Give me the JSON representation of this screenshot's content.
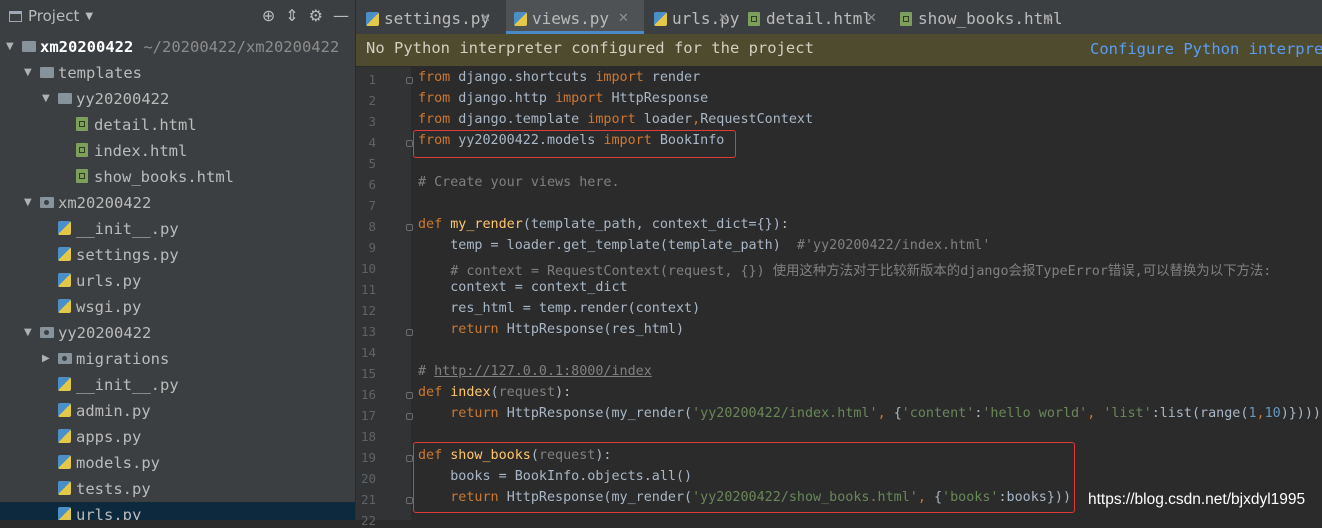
{
  "sidebar": {
    "title": "Project",
    "tools": [
      "target-icon",
      "collapse-icon",
      "gear-icon",
      "hide-icon"
    ],
    "tree": [
      {
        "name": "xm20200422",
        "path": "~/20200422/xm20200422",
        "type": "root",
        "expanded": true
      },
      {
        "name": "templates",
        "type": "folder",
        "expanded": true
      },
      {
        "name": "yy20200422",
        "type": "folder",
        "expanded": true
      },
      {
        "name": "detail.html",
        "type": "html"
      },
      {
        "name": "index.html",
        "type": "html"
      },
      {
        "name": "show_books.html",
        "type": "html"
      },
      {
        "name": "xm20200422",
        "type": "package",
        "expanded": true
      },
      {
        "name": "__init__.py",
        "type": "py"
      },
      {
        "name": "settings.py",
        "type": "py"
      },
      {
        "name": "urls.py",
        "type": "py"
      },
      {
        "name": "wsgi.py",
        "type": "py"
      },
      {
        "name": "yy20200422",
        "type": "package",
        "expanded": true
      },
      {
        "name": "migrations",
        "type": "package",
        "expanded": false
      },
      {
        "name": "__init__.py",
        "type": "py"
      },
      {
        "name": "admin.py",
        "type": "py"
      },
      {
        "name": "apps.py",
        "type": "py"
      },
      {
        "name": "models.py",
        "type": "py"
      },
      {
        "name": "tests.py",
        "type": "py"
      },
      {
        "name": "urls.py",
        "type": "py",
        "selected": true
      }
    ]
  },
  "tabs": [
    {
      "label": "settings.py",
      "type": "py",
      "active": false
    },
    {
      "label": "views.py",
      "type": "py",
      "active": true
    },
    {
      "label": "urls.py",
      "type": "py",
      "active": false
    },
    {
      "label": "detail.html",
      "type": "html",
      "active": false
    },
    {
      "label": "show_books.html",
      "type": "html",
      "active": false
    }
  ],
  "banner": {
    "message": "No Python interpreter configured for the project",
    "link": "Configure Python interpreter"
  },
  "editor": {
    "lines": [
      {
        "n": "1",
        "spans": [
          [
            "kw",
            "from"
          ],
          [
            "t",
            " django.shortcuts "
          ],
          [
            "kw",
            "import"
          ],
          [
            "t",
            " render"
          ]
        ]
      },
      {
        "n": "2",
        "spans": [
          [
            "kw",
            "from"
          ],
          [
            "t",
            " django.http "
          ],
          [
            "kw",
            "import"
          ],
          [
            "t",
            " HttpResponse"
          ]
        ]
      },
      {
        "n": "3",
        "spans": [
          [
            "kw",
            "from"
          ],
          [
            "t",
            " django.template "
          ],
          [
            "kw",
            "import"
          ],
          [
            "t",
            " loader"
          ],
          [
            "kw",
            ","
          ],
          [
            "t",
            "RequestContext"
          ]
        ]
      },
      {
        "n": "4",
        "spans": [
          [
            "kw",
            "from"
          ],
          [
            "t",
            " yy20200422.models "
          ],
          [
            "kw",
            "import"
          ],
          [
            "t",
            " BookInfo"
          ]
        ]
      },
      {
        "n": "5",
        "spans": []
      },
      {
        "n": "6",
        "spans": [
          [
            "cm",
            "# Create your views here."
          ]
        ]
      },
      {
        "n": "7",
        "spans": []
      },
      {
        "n": "8",
        "spans": [
          [
            "kw",
            "def "
          ],
          [
            "fn",
            "my_render"
          ],
          [
            "t",
            "(template_path, context_dict={}):"
          ]
        ]
      },
      {
        "n": "9",
        "spans": [
          [
            "t",
            "    temp = loader.get_template(template_path)  "
          ],
          [
            "cm",
            "#'yy20200422/index.html'"
          ]
        ]
      },
      {
        "n": "10",
        "spans": [
          [
            "cm",
            "    # context = RequestContext(request, {}) 使用这种方法对于比较新版本的django会报TypeError错误,可以替换为以下方法:"
          ]
        ]
      },
      {
        "n": "11",
        "spans": [
          [
            "t",
            "    context = context_dict"
          ]
        ]
      },
      {
        "n": "12",
        "spans": [
          [
            "t",
            "    res_html = temp.render(context)"
          ]
        ]
      },
      {
        "n": "13",
        "spans": [
          [
            "kw",
            "    return "
          ],
          [
            "t",
            "HttpResponse(res_html)"
          ]
        ]
      },
      {
        "n": "14",
        "spans": []
      },
      {
        "n": "15",
        "spans": [
          [
            "cm",
            "# "
          ],
          [
            "url",
            "http://127.0.0.1:8000/index"
          ]
        ]
      },
      {
        "n": "16",
        "spans": [
          [
            "kw",
            "def "
          ],
          [
            "fn",
            "index"
          ],
          [
            "t",
            "("
          ],
          [
            "par",
            "request"
          ],
          [
            "t",
            "):"
          ]
        ]
      },
      {
        "n": "17",
        "spans": [
          [
            "kw",
            "    return "
          ],
          [
            "t",
            "HttpResponse(my_render("
          ],
          [
            "str",
            "'yy20200422/index.html'"
          ],
          [
            "kw",
            ", "
          ],
          [
            "t",
            "{"
          ],
          [
            "str",
            "'content'"
          ],
          [
            "t",
            ":"
          ],
          [
            "str",
            "'hello world'"
          ],
          [
            "kw",
            ", "
          ],
          [
            "str",
            "'list'"
          ],
          [
            "t",
            ":list(range("
          ],
          [
            "num",
            "1"
          ],
          [
            "kw",
            ","
          ],
          [
            "num",
            "10"
          ],
          [
            "t",
            ")})))"
          ]
        ]
      },
      {
        "n": "18",
        "spans": []
      },
      {
        "n": "19",
        "spans": [
          [
            "kw",
            "def "
          ],
          [
            "fn",
            "show_books"
          ],
          [
            "t",
            "("
          ],
          [
            "par",
            "request"
          ],
          [
            "t",
            "):"
          ]
        ]
      },
      {
        "n": "20",
        "spans": [
          [
            "t",
            "    books = BookInfo.objects.all()"
          ]
        ]
      },
      {
        "n": "21",
        "spans": [
          [
            "kw",
            "    return "
          ],
          [
            "t",
            "HttpResponse(my_render("
          ],
          [
            "str",
            "'yy20200422/show_books.html'"
          ],
          [
            "kw",
            ", "
          ],
          [
            "t",
            "{"
          ],
          [
            "str",
            "'books'"
          ],
          [
            "t",
            ":books}))"
          ]
        ]
      },
      {
        "n": "22",
        "spans": []
      }
    ]
  },
  "watermark": "https://blog.csdn.net/bjxdyl1995",
  "colors": {
    "keyword": "#cc7832",
    "function": "#ffc66d",
    "string": "#6a8759",
    "comment": "#808080",
    "number": "#6897bb",
    "highlight": "#e03a3a"
  }
}
